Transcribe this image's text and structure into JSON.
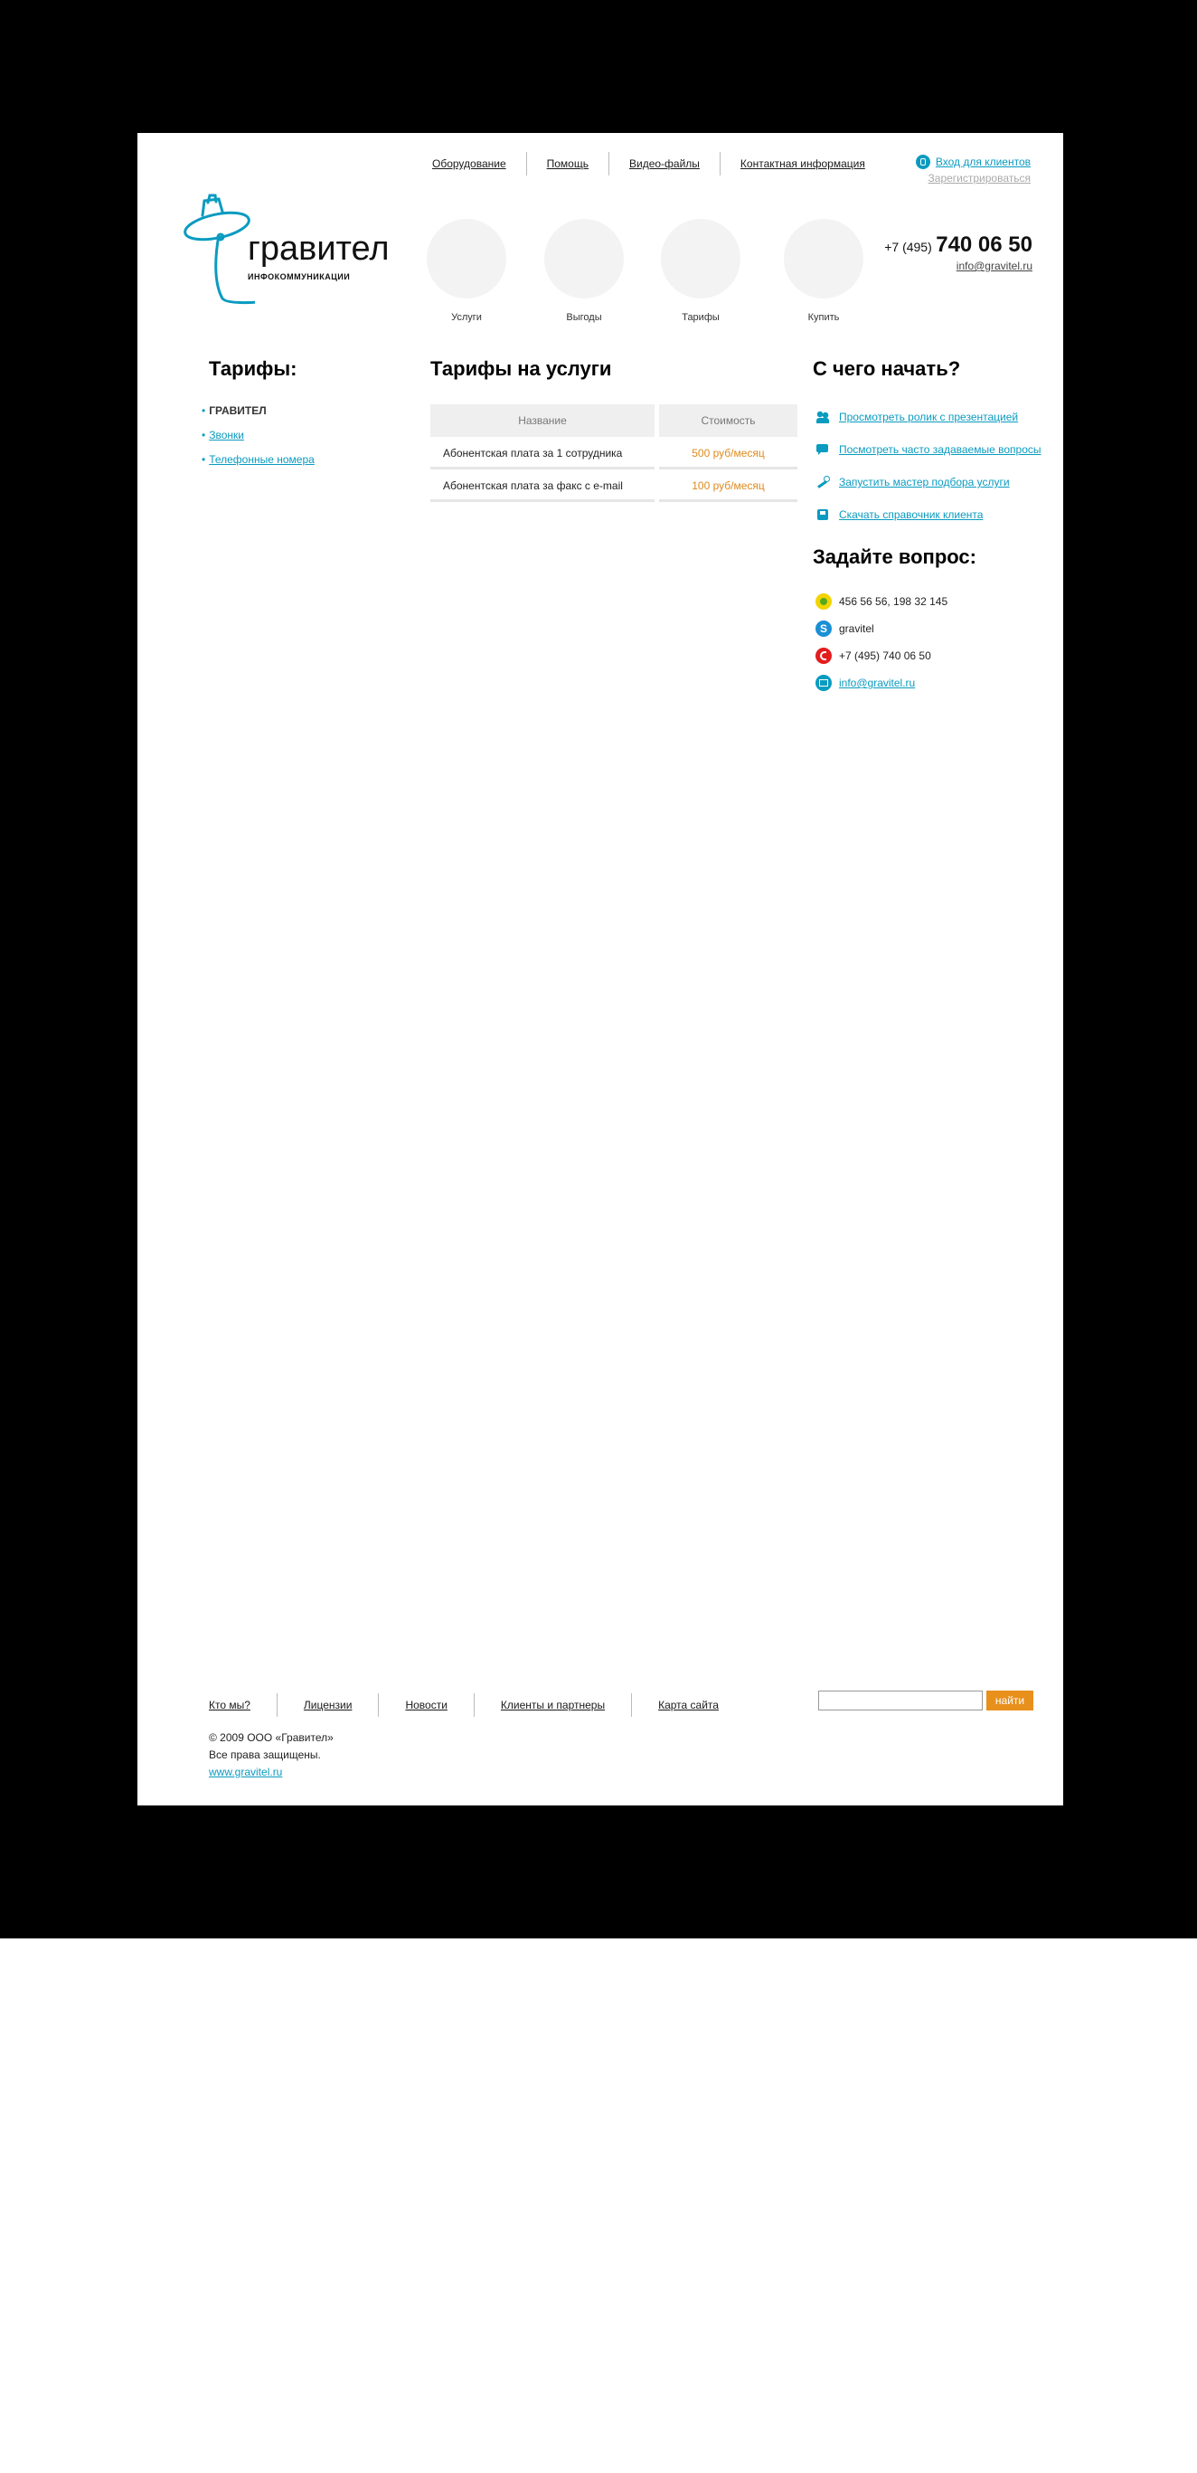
{
  "colors": {
    "accent": "#0a9bc0",
    "price": "#e08a1a",
    "button": "#e8901c"
  },
  "header": {
    "nav": [
      "Оборудование",
      "Помощь",
      "Видео-файлы",
      "Контактная информация"
    ],
    "login": {
      "label": "Вход для клиентов",
      "register": "Зарегистрироваться"
    },
    "logo": {
      "brand": "гравител",
      "sub": "ИНФОКОММУНИКАЦИИ"
    },
    "circles": [
      "Услуги",
      "Выгоды",
      "Тарифы",
      "Купить"
    ],
    "phone": {
      "prefix": "+7 (495)",
      "number": "740 06 50",
      "email": "info@gravitel.ru"
    }
  },
  "left": {
    "title": "Тарифы:",
    "items": [
      {
        "label": "ГРАВИТЕЛ",
        "active": true
      },
      {
        "label": "Звонки",
        "active": false
      },
      {
        "label": "Телефонные номера",
        "active": false
      }
    ]
  },
  "center": {
    "title": "Тарифы на услуги",
    "columns": [
      "Название",
      "Стоимость"
    ],
    "rows": [
      {
        "name": "Абонентская плата за 1 сотрудника",
        "price": "500 руб/месяц"
      },
      {
        "name": "Абонентская плата за факс с e-mail",
        "price": "100 руб/месяц"
      }
    ]
  },
  "right": {
    "start_title": "С чего начать?",
    "start_links": [
      {
        "icon": "people-icon",
        "label": "Просмотреть ролик с презентацией"
      },
      {
        "icon": "chat-bubble-icon",
        "label": "Посмотреть часто задаваемые вопросы"
      },
      {
        "icon": "magic-wand-icon",
        "label": "Запустить мастер подбора услуги"
      },
      {
        "icon": "floppy-disk-icon",
        "label": "Скачать справочник клиента"
      }
    ],
    "ask_title": "Задайте вопрос:",
    "contacts": [
      {
        "icon": "icq-icon",
        "label": "456 56 56, 198 32 145",
        "link": false
      },
      {
        "icon": "skype-icon",
        "label": "gravitel",
        "link": false
      },
      {
        "icon": "phone-icon",
        "label": "+7 (495) 740 06 50",
        "link": false
      },
      {
        "icon": "mail-icon",
        "label": "info@gravitel.ru",
        "link": true
      }
    ]
  },
  "footer": {
    "nav": [
      "Кто мы?",
      "Лицензии",
      "Новости",
      "Клиенты и партнеры",
      "Карта сайта"
    ],
    "search": {
      "value": "",
      "button": "найти"
    },
    "copyright": "© 2009 ООО «Гравител»",
    "rights": "Все права защищены.",
    "site": "www.gravitel.ru"
  }
}
